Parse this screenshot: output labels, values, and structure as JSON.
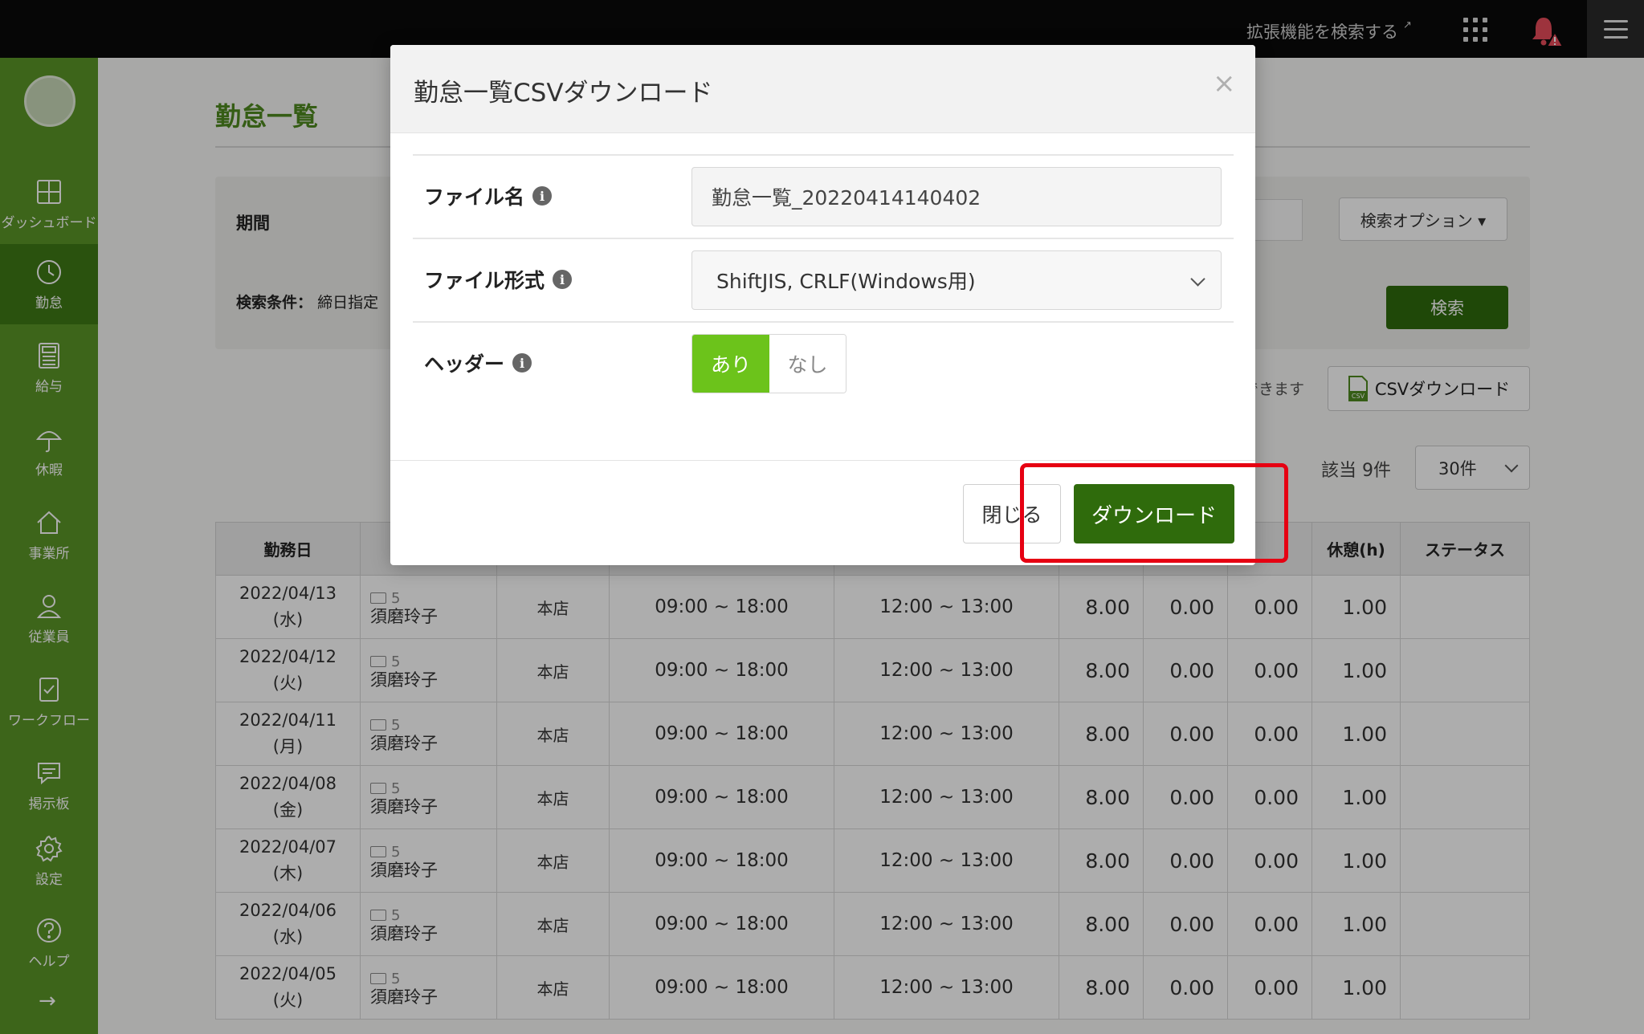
{
  "topbar": {
    "ext_search_label": "拡張機能を検索する",
    "ext_icon": "external-link-icon",
    "apps_icon": "apps-grid-icon",
    "bell_icon": "bell-alert-icon",
    "menu_icon": "hamburger-menu-icon"
  },
  "sidebar": {
    "items": [
      {
        "label": "ダッシュボード",
        "icon": "dashboard-icon"
      },
      {
        "label": "勤怠",
        "icon": "clock-icon"
      },
      {
        "label": "給与",
        "icon": "calculator-icon"
      },
      {
        "label": "休暇",
        "icon": "umbrella-icon"
      },
      {
        "label": "事業所",
        "icon": "home-icon"
      },
      {
        "label": "従業員",
        "icon": "person-icon"
      },
      {
        "label": "ワークフロー",
        "icon": "workflow-icon"
      },
      {
        "label": "掲示板",
        "icon": "chat-icon"
      },
      {
        "label": "設定",
        "icon": "gear-icon"
      },
      {
        "label": "ヘルプ",
        "icon": "help-icon"
      }
    ],
    "collapse_arrow": "→",
    "accent_color": "#5a9527"
  },
  "page": {
    "title": "勤怠一覧",
    "period_label": "期間",
    "condition_label": "検索条件：",
    "condition_value": "締日指定",
    "search_option_label": "検索オプション ▾",
    "search_button": "検索",
    "download_hint": "できます",
    "csv_download_button": "CSVダウンロード",
    "hit_count": "該当 9件",
    "per_page": "30件"
  },
  "table": {
    "headers": [
      "勤務日",
      "",
      "",
      "",
      "",
      "",
      "",
      "",
      "休憩(h)",
      "ステータス"
    ],
    "rows": [
      {
        "date": "2022/04/13",
        "dow": "(水)",
        "emp_no": "5",
        "emp_name": "須磨玲子",
        "store": "本店",
        "work": "09:00 ~ 18:00",
        "break": "12:00 ~ 13:00",
        "v1": "8.00",
        "v2": "0.00",
        "v3": "0.00",
        "rest": "1.00",
        "status": ""
      },
      {
        "date": "2022/04/12",
        "dow": "(火)",
        "emp_no": "5",
        "emp_name": "須磨玲子",
        "store": "本店",
        "work": "09:00 ~ 18:00",
        "break": "12:00 ~ 13:00",
        "v1": "8.00",
        "v2": "0.00",
        "v3": "0.00",
        "rest": "1.00",
        "status": ""
      },
      {
        "date": "2022/04/11",
        "dow": "(月)",
        "emp_no": "5",
        "emp_name": "須磨玲子",
        "store": "本店",
        "work": "09:00 ~ 18:00",
        "break": "12:00 ~ 13:00",
        "v1": "8.00",
        "v2": "0.00",
        "v3": "0.00",
        "rest": "1.00",
        "status": ""
      },
      {
        "date": "2022/04/08",
        "dow": "(金)",
        "emp_no": "5",
        "emp_name": "須磨玲子",
        "store": "本店",
        "work": "09:00 ~ 18:00",
        "break": "12:00 ~ 13:00",
        "v1": "8.00",
        "v2": "0.00",
        "v3": "0.00",
        "rest": "1.00",
        "status": ""
      },
      {
        "date": "2022/04/07",
        "dow": "(木)",
        "emp_no": "5",
        "emp_name": "須磨玲子",
        "store": "本店",
        "work": "09:00 ~ 18:00",
        "break": "12:00 ~ 13:00",
        "v1": "8.00",
        "v2": "0.00",
        "v3": "0.00",
        "rest": "1.00",
        "status": ""
      },
      {
        "date": "2022/04/06",
        "dow": "(水)",
        "emp_no": "5",
        "emp_name": "須磨玲子",
        "store": "本店",
        "work": "09:00 ~ 18:00",
        "break": "12:00 ~ 13:00",
        "v1": "8.00",
        "v2": "0.00",
        "v3": "0.00",
        "rest": "1.00",
        "status": ""
      },
      {
        "date": "2022/04/05",
        "dow": "(火)",
        "emp_no": "5",
        "emp_name": "須磨玲子",
        "store": "本店",
        "work": "09:00 ~ 18:00",
        "break": "12:00 ~ 13:00",
        "v1": "8.00",
        "v2": "0.00",
        "v3": "0.00",
        "rest": "1.00",
        "status": ""
      }
    ]
  },
  "modal": {
    "title": "勤怠一覧CSVダウンロード",
    "close_symbol": "×",
    "filename_label": "ファイル名",
    "filename_value": "勤怠一覧_20220414140402",
    "format_label": "ファイル形式",
    "format_value": "ShiftJIS, CRLF(Windows用)",
    "header_label": "ヘッダー",
    "header_yes": "あり",
    "header_no": "なし",
    "info_symbol": "i",
    "close_button": "閉じる",
    "download_button": "ダウンロード",
    "primary_color": "#2f6b0c",
    "toggle_on_color": "#6cc31b",
    "highlight_color": "#e60012"
  }
}
